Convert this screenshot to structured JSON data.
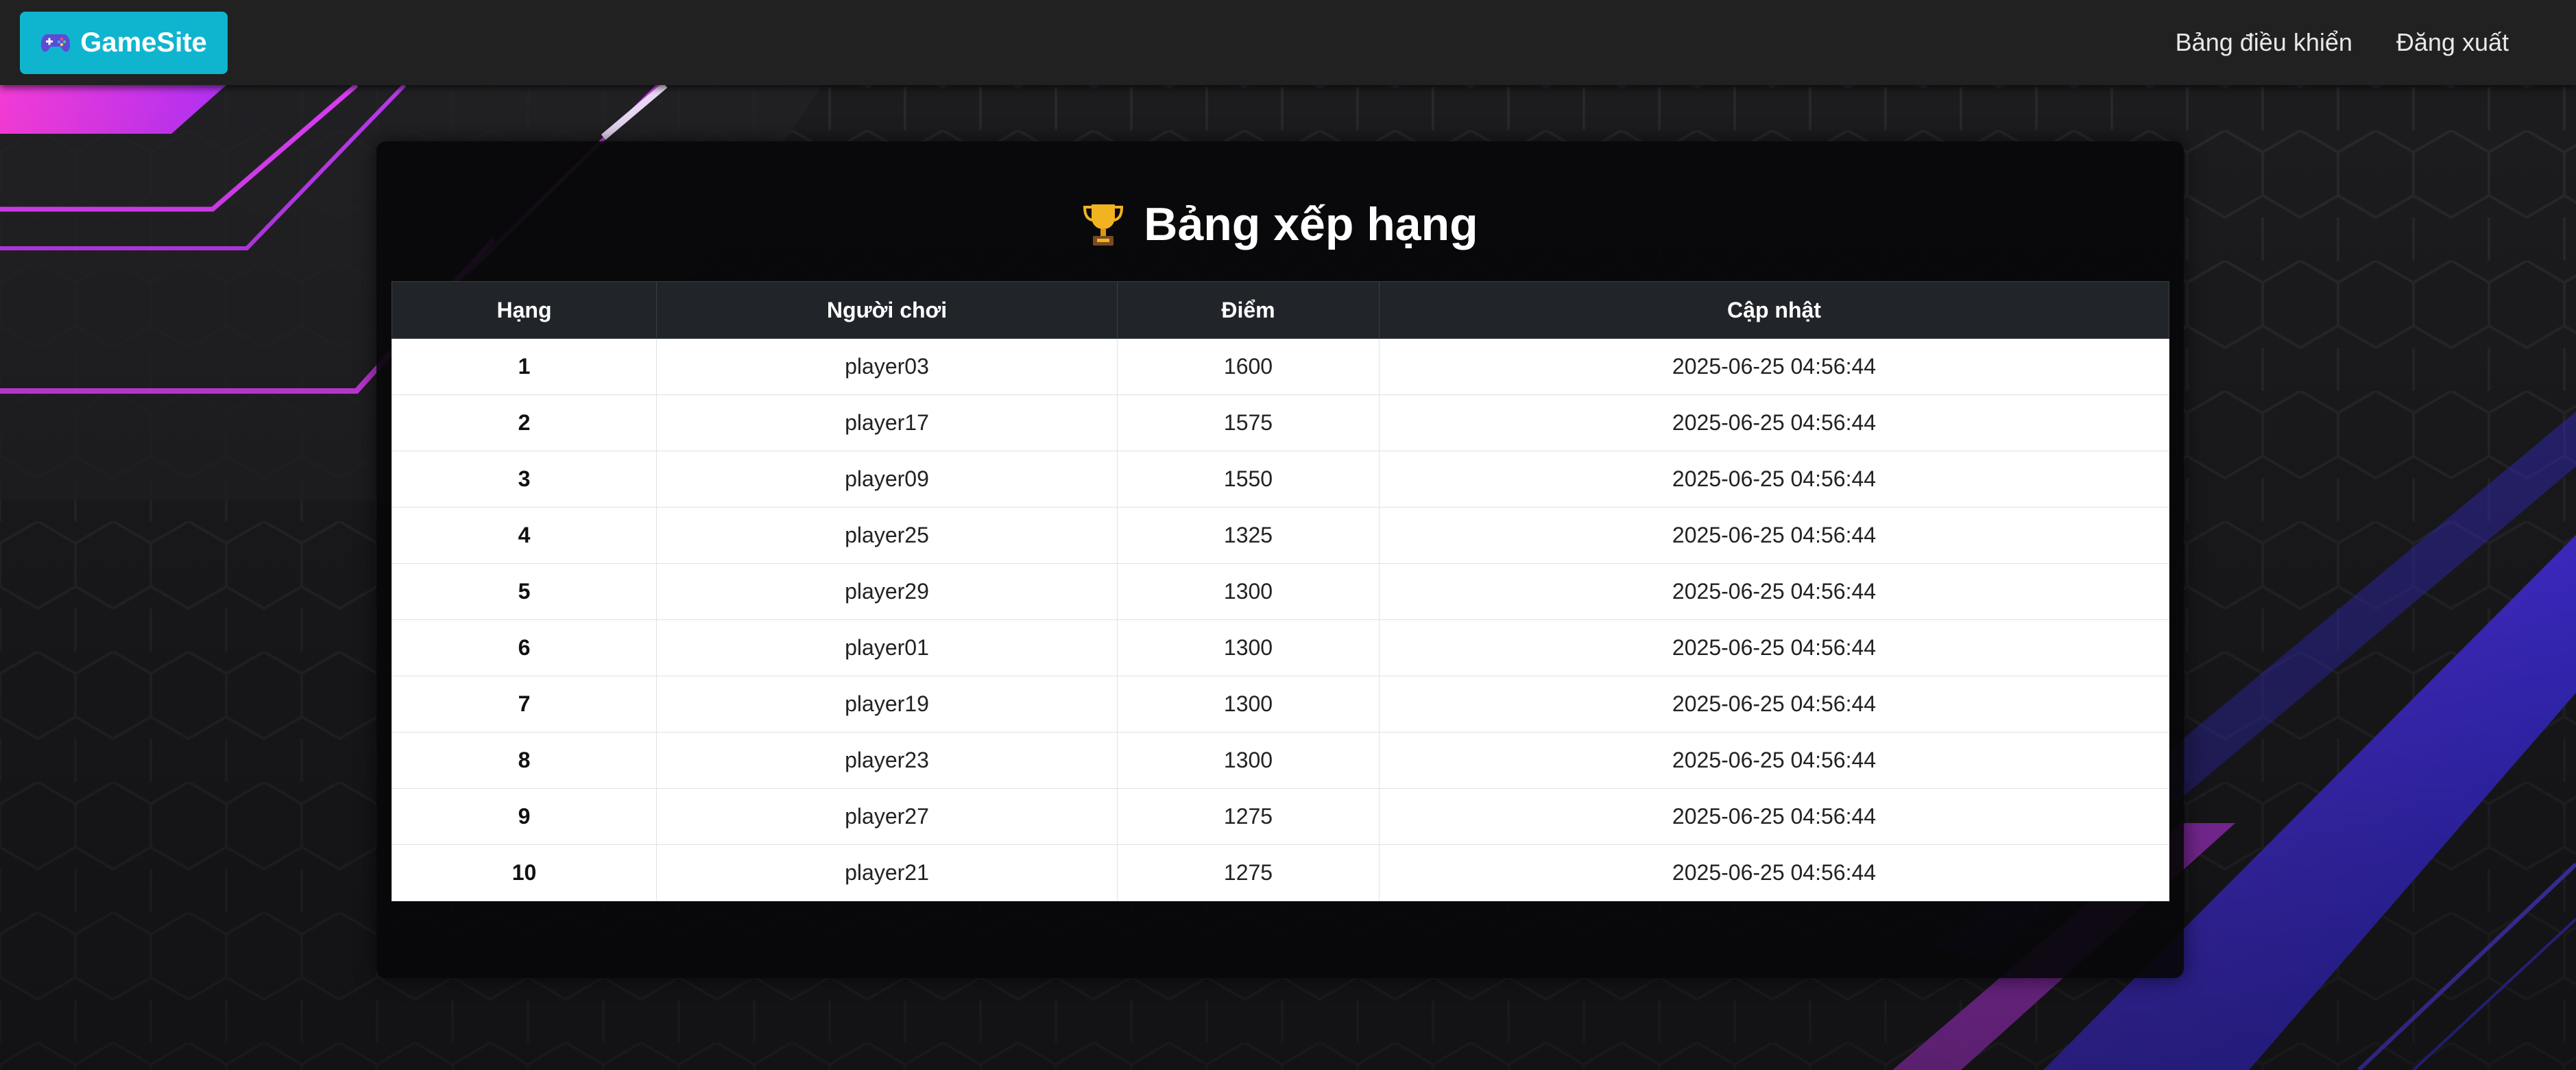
{
  "navbar": {
    "brand_label": "GameSite",
    "brand_icon": "gamepad-icon",
    "links": [
      {
        "label": "Bảng điều khiển"
      },
      {
        "label": "Đăng xuất"
      }
    ]
  },
  "page": {
    "title": "Bảng xếp hạng",
    "title_icon": "trophy-icon"
  },
  "leaderboard": {
    "headers": [
      "Hạng",
      "Người chơi",
      "Điểm",
      "Cập nhật"
    ],
    "rows": [
      {
        "rank": "1",
        "player": "player03",
        "score": "1600",
        "updated": "2025-06-25 04:56:44"
      },
      {
        "rank": "2",
        "player": "player17",
        "score": "1575",
        "updated": "2025-06-25 04:56:44"
      },
      {
        "rank": "3",
        "player": "player09",
        "score": "1550",
        "updated": "2025-06-25 04:56:44"
      },
      {
        "rank": "4",
        "player": "player25",
        "score": "1325",
        "updated": "2025-06-25 04:56:44"
      },
      {
        "rank": "5",
        "player": "player29",
        "score": "1300",
        "updated": "2025-06-25 04:56:44"
      },
      {
        "rank": "6",
        "player": "player01",
        "score": "1300",
        "updated": "2025-06-25 04:56:44"
      },
      {
        "rank": "7",
        "player": "player19",
        "score": "1300",
        "updated": "2025-06-25 04:56:44"
      },
      {
        "rank": "8",
        "player": "player23",
        "score": "1300",
        "updated": "2025-06-25 04:56:44"
      },
      {
        "rank": "9",
        "player": "player27",
        "score": "1275",
        "updated": "2025-06-25 04:56:44"
      },
      {
        "rank": "10",
        "player": "player21",
        "score": "1275",
        "updated": "2025-06-25 04:56:44"
      }
    ]
  },
  "colors": {
    "brand": "#0fb5cf",
    "navbar": "#212121",
    "table_header": "#212529",
    "accent_magenta": "#e040fb",
    "accent_blue": "#4b3bff"
  }
}
